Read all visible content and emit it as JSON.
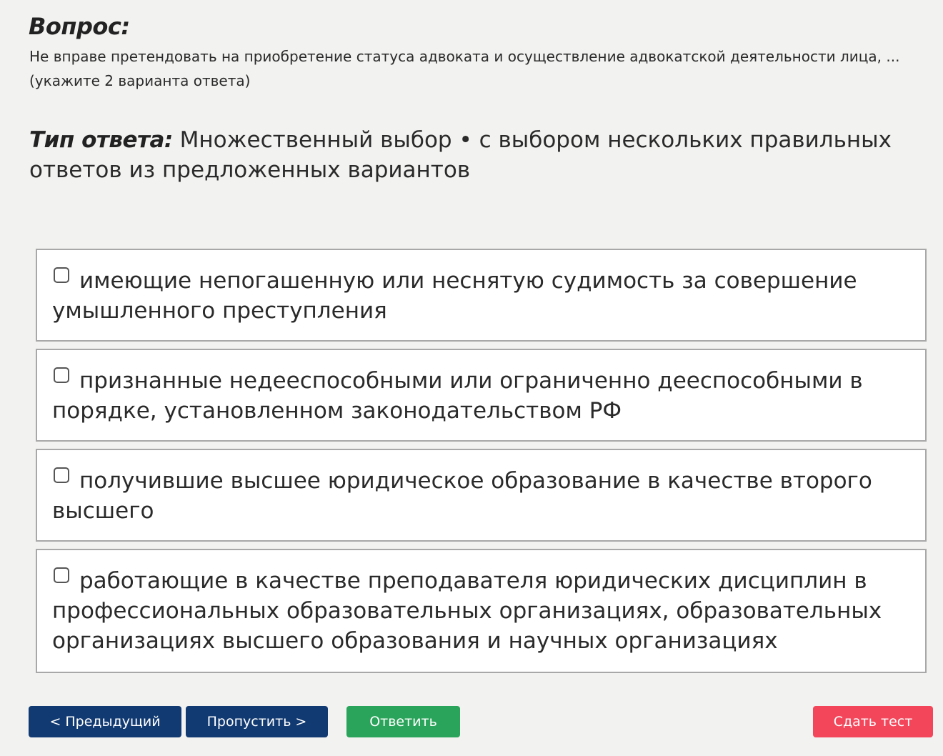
{
  "question": {
    "heading": "Вопрос:",
    "line1": "Не вправе претендовать на приобретение статуса адвоката и осуществление адвокатской деятельности лица, ...",
    "line2": "(укажите 2 варианта ответа)"
  },
  "answer_type": {
    "label": "Тип ответа:",
    "value": "Множественный выбор • с выбором нескольких правильных ответов из предложенных вариантов"
  },
  "options": [
    {
      "text": "имеющие непогашенную или неснятую судимость за совершение умышленного преступления",
      "checked": false
    },
    {
      "text": "признанные недееспособными или ограниченно дееспособными в порядке, установленном законодательством РФ",
      "checked": false
    },
    {
      "text": "получившие высшее юридическое образование в качестве второго высшего",
      "checked": false
    },
    {
      "text": "работающие в качестве преподавателя юридических дисциплин в профессиональных образовательных организациях, образовательных организациях высшего образования и научных организациях",
      "checked": false
    }
  ],
  "buttons": {
    "prev": "< Предыдущий",
    "skip": "Пропустить >",
    "answer": "Ответить",
    "finish": "Сдать тест"
  },
  "colors": {
    "background": "#f2f2f0",
    "primary_button": "#123a72",
    "answer_button": "#2aa45a",
    "finish_button": "#f3465a",
    "option_border": "#a8a8a8"
  }
}
